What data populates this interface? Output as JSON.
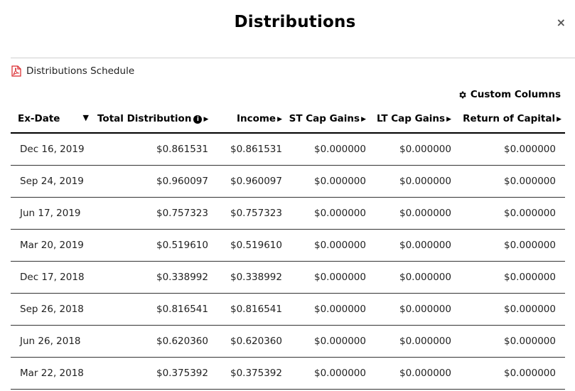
{
  "modal": {
    "title": "Distributions",
    "close_label": "×"
  },
  "schedule_link": {
    "label": "Distributions Schedule",
    "icon": "pdf-icon",
    "icon_color": "#d9252a"
  },
  "custom_columns": {
    "label": "Custom Columns",
    "icon": "gear-icon"
  },
  "table": {
    "columns": [
      {
        "label": "Ex-Date",
        "sort": "descending"
      },
      {
        "label": "Total Distribution",
        "info_icon": true
      },
      {
        "label": "Income"
      },
      {
        "label": "ST Cap Gains"
      },
      {
        "label": "LT Cap Gains"
      },
      {
        "label": "Return of Capital"
      }
    ],
    "rows": [
      [
        "Dec 16, 2019",
        "$0.861531",
        "$0.861531",
        "$0.000000",
        "$0.000000",
        "$0.000000"
      ],
      [
        "Sep 24, 2019",
        "$0.960097",
        "$0.960097",
        "$0.000000",
        "$0.000000",
        "$0.000000"
      ],
      [
        "Jun 17, 2019",
        "$0.757323",
        "$0.757323",
        "$0.000000",
        "$0.000000",
        "$0.000000"
      ],
      [
        "Mar 20, 2019",
        "$0.519610",
        "$0.519610",
        "$0.000000",
        "$0.000000",
        "$0.000000"
      ],
      [
        "Dec 17, 2018",
        "$0.338992",
        "$0.338992",
        "$0.000000",
        "$0.000000",
        "$0.000000"
      ],
      [
        "Sep 26, 2018",
        "$0.816541",
        "$0.816541",
        "$0.000000",
        "$0.000000",
        "$0.000000"
      ],
      [
        "Jun 26, 2018",
        "$0.620360",
        "$0.620360",
        "$0.000000",
        "$0.000000",
        "$0.000000"
      ],
      [
        "Mar 22, 2018",
        "$0.375392",
        "$0.375392",
        "$0.000000",
        "$0.000000",
        "$0.000000"
      ]
    ]
  }
}
